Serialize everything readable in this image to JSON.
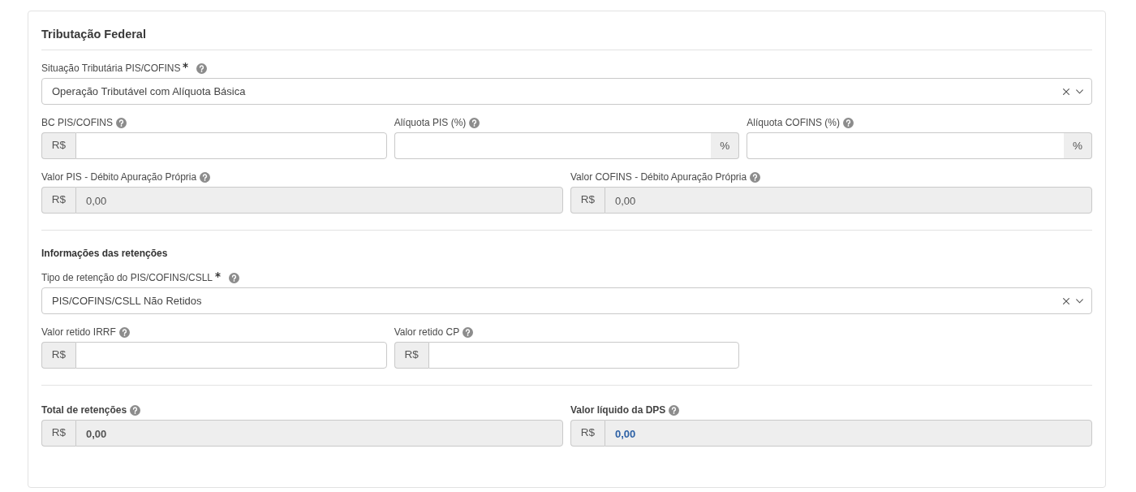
{
  "title": "Tributação Federal",
  "sections": [
    {
      "rows": [
        {
          "kind": "full",
          "fields": [
            {
              "kind": "select",
              "label": "Situação Tributária PIS/COFINS",
              "required": true,
              "help": true,
              "value": "Operação Tributável com Alíquota Básica"
            }
          ]
        },
        {
          "kind": "thirds",
          "fields": [
            {
              "kind": "input",
              "label": "BC PIS/COFINS",
              "required": false,
              "help": true,
              "prefix": "R$",
              "readonly": false
            },
            {
              "kind": "input",
              "label": "Alíquota PIS (%)",
              "required": false,
              "help": true,
              "suffix": "%",
              "readonly": false
            },
            {
              "kind": "input",
              "label": "Alíquota COFINS (%)",
              "required": false,
              "help": true,
              "suffix": "%",
              "readonly": false
            }
          ]
        },
        {
          "kind": "halves",
          "fields": [
            {
              "kind": "input",
              "label": "Valor PIS - Débito Apuração Própria",
              "required": false,
              "help": true,
              "prefix": "R$",
              "value": "0,00",
              "readonly": true
            },
            {
              "kind": "input",
              "label": "Valor COFINS - Débito Apuração Própria",
              "required": false,
              "help": true,
              "prefix": "R$",
              "value": "0,00",
              "readonly": true
            }
          ]
        }
      ]
    },
    {
      "heading": "Informações das retenções",
      "rows": [
        {
          "kind": "full",
          "fields": [
            {
              "kind": "select",
              "label": "Tipo de retenção do PIS/COFINS/CSLL",
              "required": true,
              "help": true,
              "value": "PIS/COFINS/CSLL Não Retidos"
            }
          ]
        },
        {
          "kind": "thirds",
          "fields": [
            {
              "kind": "input",
              "label": "Valor retido IRRF",
              "required": false,
              "help": true,
              "prefix": "R$",
              "readonly": false
            },
            {
              "kind": "input",
              "label": "Valor retido CP",
              "required": false,
              "help": true,
              "prefix": "R$",
              "readonly": false
            }
          ]
        }
      ]
    },
    {
      "rows": [
        {
          "kind": "halves",
          "fields": [
            {
              "kind": "input",
              "label": "Total de retenções",
              "required": false,
              "help": true,
              "prefix": "R$",
              "value": "0,00",
              "readonly": true,
              "bold": true,
              "accent": false
            },
            {
              "kind": "input",
              "label": "Valor líquido da DPS",
              "required": false,
              "help": true,
              "prefix": "R$",
              "value": "0,00",
              "readonly": true,
              "bold": true,
              "accent": true
            }
          ]
        }
      ]
    }
  ]
}
